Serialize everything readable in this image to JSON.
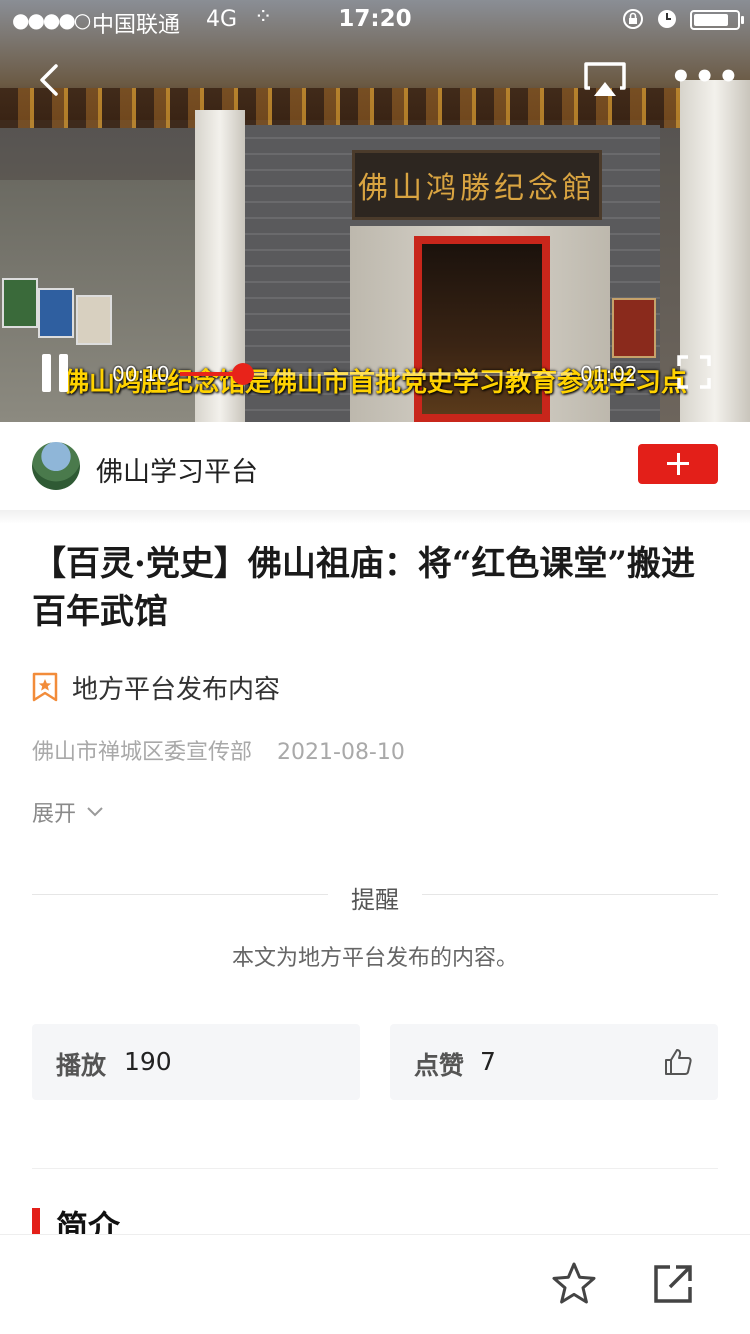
{
  "status_bar": {
    "signal": "●●●●○",
    "carrier": "中国联通",
    "network": "4G",
    "loading": "⁘",
    "time": "17:20",
    "battery_level": 0.8
  },
  "video": {
    "sign_text": "佛山鸿勝纪念館",
    "subtitle": "佛山鸿胜纪念馆是佛山市首批党史学习教育参观学习点",
    "current_time": "00:10",
    "duration": "01:02",
    "progress": 0.16,
    "accent_color": "#e8231a"
  },
  "publisher": {
    "name": "佛山学习平台"
  },
  "article": {
    "title": "【百灵·党史】佛山祖庙：将“红色课堂”搬进百年武馆",
    "source_tag": "地方平台发布内容",
    "author": "佛山市禅城区委宣传部",
    "date": "2021-08-10",
    "expand_label": "展开"
  },
  "notice": {
    "title": "提醒",
    "text": "本文为地方平台发布的内容。"
  },
  "stats": {
    "play_label": "播放",
    "play_count": "190",
    "like_label": "点赞",
    "like_count": "7"
  },
  "intro": {
    "title": "简介"
  },
  "icons": {
    "back": "back-icon",
    "airplay": "airplay-icon",
    "more": "more-icon",
    "pause": "pause-icon",
    "fullscreen": "fullscreen-icon",
    "follow": "plus-icon",
    "source_tag": "bookmark-star-icon",
    "expand": "chevron-down-icon",
    "like": "thumb-up-icon",
    "favorite": "star-icon",
    "share": "share-icon"
  },
  "colors": {
    "brand_red": "#e31f19",
    "subtitle_yellow": "#ffd200"
  }
}
